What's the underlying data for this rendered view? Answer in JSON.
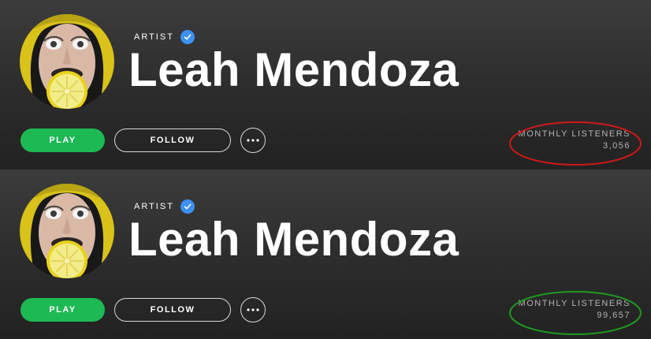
{
  "panels": [
    {
      "kind": "ARTIST",
      "artist_name": "Leah Mendoza",
      "play_label": "PLAY",
      "follow_label": "FOLLOW",
      "listeners_label": "MONTHLY LISTENERS",
      "listeners_count": "3,056",
      "highlight_color": "#d01818"
    },
    {
      "kind": "ARTIST",
      "artist_name": "Leah Mendoza",
      "play_label": "PLAY",
      "follow_label": "FOLLOW",
      "listeners_label": "MONTHLY LISTENERS",
      "listeners_count": "99,657",
      "highlight_color": "#1f9a1f"
    }
  ],
  "colors": {
    "play_button": "#1db954",
    "verified_badge": "#3d91f4"
  },
  "icons": {
    "verified": "verified-check-icon",
    "more": "more-options-icon"
  }
}
